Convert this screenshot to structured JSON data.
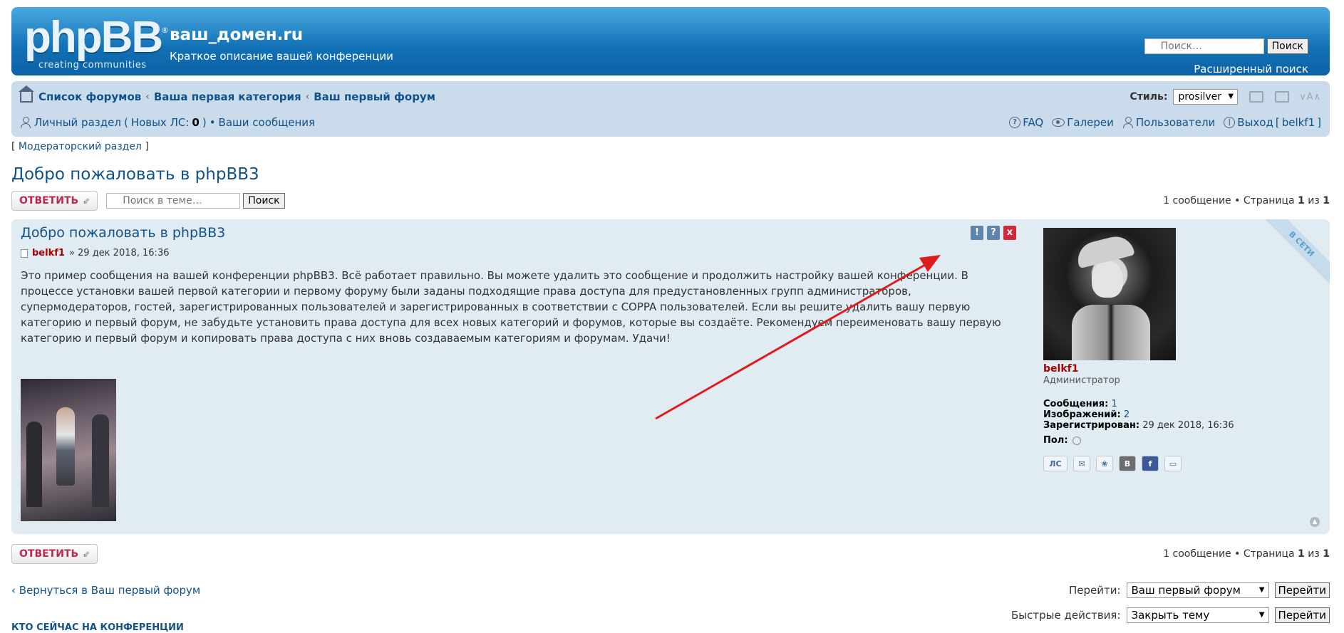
{
  "header": {
    "logo_main": "phpBB",
    "logo_sub": "creating   communities",
    "logo_reg": "®",
    "site_title": "ваш_домен.ru",
    "site_description": "Краткое описание вашей конференции",
    "search_placeholder": "Поиск…",
    "search_button": "Поиск",
    "advanced_search": "Расширенный поиск"
  },
  "navbar": {
    "breadcrumbs": [
      "Список форумов",
      "Ваша первая категория",
      "Ваш первый форум"
    ],
    "style_label": "Стиль:",
    "style_value": "prosilver",
    "font_size_label": "∨A∧",
    "ucp_label": "Личный раздел",
    "pm_label": "Новых ЛС:",
    "pm_count": "0",
    "own_posts": "Ваши сообщения",
    "links": {
      "faq": "FAQ",
      "galleries": "Галереи",
      "members": "Пользователи",
      "logout": "Выход",
      "username": "belkf1"
    }
  },
  "moderator_link": "Модераторский раздел",
  "topic": {
    "title": "Добро пожаловать в phpBB3",
    "reply_button": "ОТВЕТИТЬ",
    "reply_arrow": "⇙",
    "search_placeholder": "Поиск в теме…",
    "search_button": "Поиск",
    "pagination_count": "1 сообщение",
    "pagination_page": "Страница",
    "pagination_current": "1",
    "pagination_of": "из",
    "pagination_total": "1"
  },
  "post": {
    "title": "Добро пожаловать в phpBB3",
    "author": "belkf1",
    "date": "» 29 дек 2018, 16:36",
    "body": "Это пример сообщения на вашей конференции phpBB3. Всё работает правильно. Вы можете удалить это сообщение и продолжить настройку вашей конференции. В процессе установки вашей первой категории и первому форуму были заданы подходящие права доступа для предустановленных групп администраторов, супермодераторов, гостей, зарегистрированных пользователей и зарегистрированных в соответствии с COPPA пользователей. Если вы решите удалить вашу первую категорию и первый форум, не забудьте установить права доступа для всех новых категорий и форумов, которые вы создаёте. Рекомендуем переименовать вашу первую категорию и первый форум и копировать права доступа с них вновь создаваемым категориям и форумам. Удачи!",
    "tools": {
      "report": "!",
      "info": "?",
      "delete": "x"
    },
    "online_badge": "В СЕТИ",
    "back_to_top": "▲"
  },
  "profile": {
    "username": "belkf1",
    "rank": "Администратор",
    "posts_label": "Сообщения:",
    "posts_value": "1",
    "images_label": "Изображений:",
    "images_value": "2",
    "registered_label": "Зарегистрирован:",
    "registered_value": "29 дек 2018, 16:36",
    "gender_label": "Пол:",
    "contact": {
      "pm": "ЛС",
      "email": "✉",
      "icq": "❀",
      "vk": "В",
      "fb": "f",
      "other": "▭"
    }
  },
  "footer": {
    "return_link": "Вернуться в Ваш первый форум",
    "jump_label": "Перейти:",
    "jump_value": "Ваш первый форум",
    "jump_button": "Перейти",
    "quick_label": "Быстрые действия:",
    "quick_value": "Закрыть тему",
    "quick_button": "Перейти",
    "who_online": "Кто сейчас на конференции"
  }
}
